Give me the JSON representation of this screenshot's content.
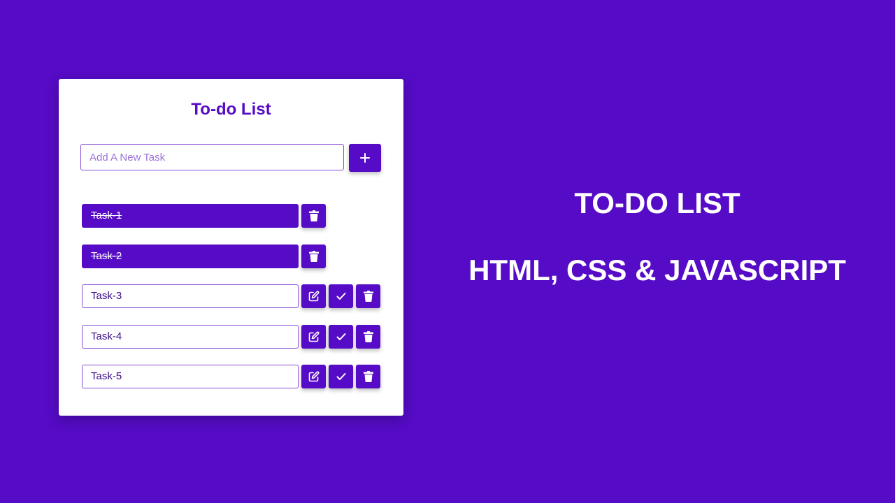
{
  "app": {
    "title": "To-do List",
    "input_placeholder": "Add A New Task",
    "input_value": "",
    "add_icon": "plus-icon"
  },
  "tasks": [
    {
      "label": "Task-1",
      "completed": true
    },
    {
      "label": "Task-2",
      "completed": true
    },
    {
      "label": "Task-3",
      "completed": false
    },
    {
      "label": "Task-4",
      "completed": false
    },
    {
      "label": "Task-5",
      "completed": false
    }
  ],
  "actions": {
    "edit_icon": "edit-icon",
    "complete_icon": "check-icon",
    "delete_icon": "trash-icon"
  },
  "banner": {
    "line1": "TO-DO LIST",
    "line2": "HTML, CSS & JAVASCRIPT"
  },
  "colors": {
    "background": "#560bc6",
    "accent": "#560bc6",
    "card": "#ffffff"
  }
}
